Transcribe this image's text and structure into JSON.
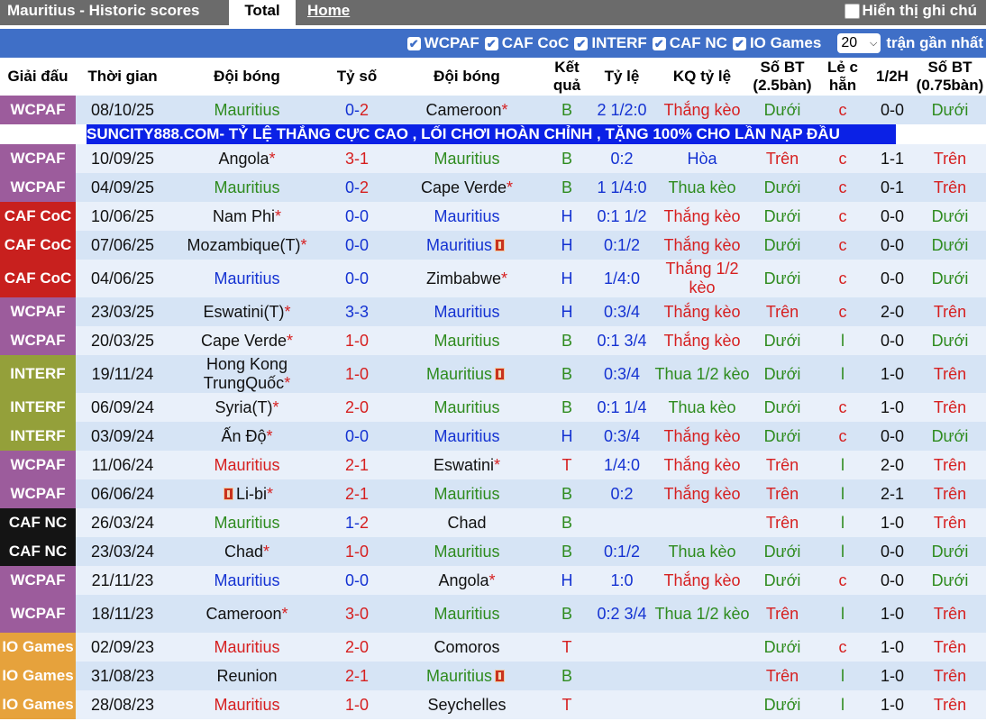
{
  "header": {
    "title": "Mauritius - Historic scores",
    "tab_total": "Total",
    "tab_home": "Home",
    "show_notes_label": "Hiển thị ghi chú"
  },
  "filters": {
    "items": [
      "WCPAF",
      "CAF CoC",
      "INTERF",
      "CAF NC",
      "IO Games"
    ],
    "select_value": "20",
    "recent_label": "trận gần nhất"
  },
  "columns": [
    "Giải đấu",
    "Thời gian",
    "Đội bóng",
    "Tỷ số",
    "Đội bóng",
    "Kết quả",
    "Tỷ lệ",
    "KQ tỷ lệ",
    "Số BT (2.5bàn)",
    "Lẻ c hẵn",
    "1/2H",
    "Số BT (0.75bàn)"
  ],
  "colors": {
    "WCPAF": "#9c5c9c",
    "CAF CoC": "#c8201e",
    "INTERF": "#94a03a",
    "CAF NC": "#141414",
    "IO Games": "#e6a23c",
    "ad_bg": "#0b21e6",
    "filter_bar": "#3f6fc7"
  },
  "ad_banner": "SUNCITY888.COM- TỶ LỆ THẮNG CỰC CAO , LỐI CHƠI HOÀN CHỈNH , TẶNG 100% CHO LẦN NẠP ĐẦU",
  "rows": [
    {
      "league": "WCPAF",
      "date": "08/10/25",
      "home": "Mauritius",
      "home_color": "green",
      "home_star": false,
      "home_flag": false,
      "score_home": "0",
      "score_away": "2",
      "score_home_color": "blue",
      "score_away_color": "red",
      "away": "Cameroon",
      "away_color": "black",
      "away_star": true,
      "away_flag": false,
      "result": "B",
      "result_color": "green",
      "odds": "2 1/2:0",
      "odds_color": "blue",
      "odds_result": "Thắng kèo",
      "odds_result_color": "red",
      "ou": "Dưới",
      "ou_color": "green",
      "oe": "c",
      "oe_color": "red",
      "half": "0-0",
      "ou75": "Dưới",
      "ou75_color": "green"
    },
    {
      "league": "WCPAF",
      "date": "10/09/25",
      "home": "Angola",
      "home_color": "black",
      "home_star": true,
      "home_flag": false,
      "score_home": "3",
      "score_away": "1",
      "score_home_color": "red",
      "score_away_color": "red",
      "away": "Mauritius",
      "away_color": "green",
      "away_star": false,
      "away_flag": false,
      "result": "B",
      "result_color": "green",
      "odds": "0:2",
      "odds_color": "blue",
      "odds_result": "Hòa",
      "odds_result_color": "blue",
      "ou": "Trên",
      "ou_color": "red",
      "oe": "c",
      "oe_color": "red",
      "half": "1-1",
      "ou75": "Trên",
      "ou75_color": "red"
    },
    {
      "league": "WCPAF",
      "date": "04/09/25",
      "home": "Mauritius",
      "home_color": "green",
      "home_star": false,
      "home_flag": false,
      "score_home": "0",
      "score_away": "2",
      "score_home_color": "blue",
      "score_away_color": "red",
      "away": "Cape Verde",
      "away_color": "black",
      "away_star": true,
      "away_flag": false,
      "result": "B",
      "result_color": "green",
      "odds": "1 1/4:0",
      "odds_color": "blue",
      "odds_result": "Thua kèo",
      "odds_result_color": "green",
      "ou": "Dưới",
      "ou_color": "green",
      "oe": "c",
      "oe_color": "red",
      "half": "0-1",
      "ou75": "Trên",
      "ou75_color": "red"
    },
    {
      "league": "CAF CoC",
      "date": "10/06/25",
      "home": "Nam Phi",
      "home_color": "black",
      "home_star": true,
      "home_flag": false,
      "score_home": "0",
      "score_away": "0",
      "score_home_color": "blue",
      "score_away_color": "blue",
      "away": "Mauritius",
      "away_color": "blue",
      "away_star": false,
      "away_flag": false,
      "result": "H",
      "result_color": "blue",
      "odds": "0:1 1/2",
      "odds_color": "blue",
      "odds_result": "Thắng kèo",
      "odds_result_color": "red",
      "ou": "Dưới",
      "ou_color": "green",
      "oe": "c",
      "oe_color": "red",
      "half": "0-0",
      "ou75": "Dưới",
      "ou75_color": "green"
    },
    {
      "league": "CAF CoC",
      "date": "07/06/25",
      "home": "Mozambique(T)",
      "home_color": "black",
      "home_star": true,
      "home_flag": false,
      "score_home": "0",
      "score_away": "0",
      "score_home_color": "blue",
      "score_away_color": "blue",
      "away": "Mauritius",
      "away_color": "blue",
      "away_star": false,
      "away_flag": true,
      "result": "H",
      "result_color": "blue",
      "odds": "0:1/2",
      "odds_color": "blue",
      "odds_result": "Thắng kèo",
      "odds_result_color": "red",
      "ou": "Dưới",
      "ou_color": "green",
      "oe": "c",
      "oe_color": "red",
      "half": "0-0",
      "ou75": "Dưới",
      "ou75_color": "green"
    },
    {
      "league": "CAF CoC",
      "date": "04/06/25",
      "home": "Mauritius",
      "home_color": "blue",
      "home_star": false,
      "home_flag": false,
      "score_home": "0",
      "score_away": "0",
      "score_home_color": "blue",
      "score_away_color": "blue",
      "away": "Zimbabwe",
      "away_color": "black",
      "away_star": true,
      "away_flag": false,
      "result": "H",
      "result_color": "blue",
      "odds": "1/4:0",
      "odds_color": "blue",
      "odds_result": "Thắng 1/2 kèo",
      "odds_result_color": "red",
      "ou": "Dưới",
      "ou_color": "green",
      "oe": "c",
      "oe_color": "red",
      "half": "0-0",
      "ou75": "Dưới",
      "ou75_color": "green",
      "tall": true
    },
    {
      "league": "WCPAF",
      "date": "23/03/25",
      "home": "Eswatini(T)",
      "home_color": "black",
      "home_star": true,
      "home_flag": false,
      "score_home": "3",
      "score_away": "3",
      "score_home_color": "blue",
      "score_away_color": "blue",
      "away": "Mauritius",
      "away_color": "blue",
      "away_star": false,
      "away_flag": false,
      "result": "H",
      "result_color": "blue",
      "odds": "0:3/4",
      "odds_color": "blue",
      "odds_result": "Thắng kèo",
      "odds_result_color": "red",
      "ou": "Trên",
      "ou_color": "red",
      "oe": "c",
      "oe_color": "red",
      "half": "2-0",
      "ou75": "Trên",
      "ou75_color": "red"
    },
    {
      "league": "WCPAF",
      "date": "20/03/25",
      "home": "Cape Verde",
      "home_color": "black",
      "home_star": true,
      "home_flag": false,
      "score_home": "1",
      "score_away": "0",
      "score_home_color": "red",
      "score_away_color": "red",
      "away": "Mauritius",
      "away_color": "green",
      "away_star": false,
      "away_flag": false,
      "result": "B",
      "result_color": "green",
      "odds": "0:1 3/4",
      "odds_color": "blue",
      "odds_result": "Thắng kèo",
      "odds_result_color": "red",
      "ou": "Dưới",
      "ou_color": "green",
      "oe": "l",
      "oe_color": "green",
      "half": "0-0",
      "ou75": "Dưới",
      "ou75_color": "green"
    },
    {
      "league": "INTERF",
      "date": "19/11/24",
      "home": "Hong Kong TrungQuốc",
      "home_color": "black",
      "home_star": true,
      "home_flag": false,
      "score_home": "1",
      "score_away": "0",
      "score_home_color": "red",
      "score_away_color": "red",
      "away": "Mauritius",
      "away_color": "green",
      "away_star": false,
      "away_flag": true,
      "result": "B",
      "result_color": "green",
      "odds": "0:3/4",
      "odds_color": "blue",
      "odds_result": "Thua 1/2 kèo",
      "odds_result_color": "green",
      "ou": "Dưới",
      "ou_color": "green",
      "oe": "l",
      "oe_color": "green",
      "half": "1-0",
      "ou75": "Trên",
      "ou75_color": "red",
      "tall": true
    },
    {
      "league": "INTERF",
      "date": "06/09/24",
      "home": "Syria(T)",
      "home_color": "black",
      "home_star": true,
      "home_flag": false,
      "score_home": "2",
      "score_away": "0",
      "score_home_color": "red",
      "score_away_color": "red",
      "away": "Mauritius",
      "away_color": "green",
      "away_star": false,
      "away_flag": false,
      "result": "B",
      "result_color": "green",
      "odds": "0:1 1/4",
      "odds_color": "blue",
      "odds_result": "Thua kèo",
      "odds_result_color": "green",
      "ou": "Dưới",
      "ou_color": "green",
      "oe": "c",
      "oe_color": "red",
      "half": "1-0",
      "ou75": "Trên",
      "ou75_color": "red"
    },
    {
      "league": "INTERF",
      "date": "03/09/24",
      "home": "Ấn Độ",
      "home_color": "black",
      "home_star": true,
      "home_flag": false,
      "score_home": "0",
      "score_away": "0",
      "score_home_color": "blue",
      "score_away_color": "blue",
      "away": "Mauritius",
      "away_color": "blue",
      "away_star": false,
      "away_flag": false,
      "result": "H",
      "result_color": "blue",
      "odds": "0:3/4",
      "odds_color": "blue",
      "odds_result": "Thắng kèo",
      "odds_result_color": "red",
      "ou": "Dưới",
      "ou_color": "green",
      "oe": "c",
      "oe_color": "red",
      "half": "0-0",
      "ou75": "Dưới",
      "ou75_color": "green"
    },
    {
      "league": "WCPAF",
      "date": "11/06/24",
      "home": "Mauritius",
      "home_color": "red",
      "home_star": false,
      "home_flag": false,
      "score_home": "2",
      "score_away": "1",
      "score_home_color": "red",
      "score_away_color": "red",
      "away": "Eswatini",
      "away_color": "black",
      "away_star": true,
      "away_flag": false,
      "result": "T",
      "result_color": "red",
      "odds": "1/4:0",
      "odds_color": "blue",
      "odds_result": "Thắng kèo",
      "odds_result_color": "red",
      "ou": "Trên",
      "ou_color": "red",
      "oe": "l",
      "oe_color": "green",
      "half": "2-0",
      "ou75": "Trên",
      "ou75_color": "red"
    },
    {
      "league": "WCPAF",
      "date": "06/06/24",
      "home": "Li-bi",
      "home_color": "black",
      "home_star": true,
      "home_flag": true,
      "score_home": "2",
      "score_away": "1",
      "score_home_color": "red",
      "score_away_color": "red",
      "away": "Mauritius",
      "away_color": "green",
      "away_star": false,
      "away_flag": false,
      "result": "B",
      "result_color": "green",
      "odds": "0:2",
      "odds_color": "blue",
      "odds_result": "Thắng kèo",
      "odds_result_color": "red",
      "ou": "Trên",
      "ou_color": "red",
      "oe": "l",
      "oe_color": "green",
      "half": "2-1",
      "ou75": "Trên",
      "ou75_color": "red"
    },
    {
      "league": "CAF NC",
      "date": "26/03/24",
      "home": "Mauritius",
      "home_color": "green",
      "home_star": false,
      "home_flag": false,
      "score_home": "1",
      "score_away": "2",
      "score_home_color": "blue",
      "score_away_color": "red",
      "away": "Chad",
      "away_color": "black",
      "away_star": false,
      "away_flag": false,
      "result": "B",
      "result_color": "green",
      "odds": "",
      "odds_color": "blue",
      "odds_result": "",
      "odds_result_color": "red",
      "ou": "Trên",
      "ou_color": "red",
      "oe": "l",
      "oe_color": "green",
      "half": "1-0",
      "ou75": "Trên",
      "ou75_color": "red"
    },
    {
      "league": "CAF NC",
      "date": "23/03/24",
      "home": "Chad",
      "home_color": "black",
      "home_star": true,
      "home_flag": false,
      "score_home": "1",
      "score_away": "0",
      "score_home_color": "red",
      "score_away_color": "red",
      "away": "Mauritius",
      "away_color": "green",
      "away_star": false,
      "away_flag": false,
      "result": "B",
      "result_color": "green",
      "odds": "0:1/2",
      "odds_color": "blue",
      "odds_result": "Thua kèo",
      "odds_result_color": "green",
      "ou": "Dưới",
      "ou_color": "green",
      "oe": "l",
      "oe_color": "green",
      "half": "0-0",
      "ou75": "Dưới",
      "ou75_color": "green"
    },
    {
      "league": "WCPAF",
      "date": "21/11/23",
      "home": "Mauritius",
      "home_color": "blue",
      "home_star": false,
      "home_flag": false,
      "score_home": "0",
      "score_away": "0",
      "score_home_color": "blue",
      "score_away_color": "blue",
      "away": "Angola",
      "away_color": "black",
      "away_star": true,
      "away_flag": false,
      "result": "H",
      "result_color": "blue",
      "odds": "1:0",
      "odds_color": "blue",
      "odds_result": "Thắng kèo",
      "odds_result_color": "red",
      "ou": "Dưới",
      "ou_color": "green",
      "oe": "c",
      "oe_color": "red",
      "half": "0-0",
      "ou75": "Dưới",
      "ou75_color": "green"
    },
    {
      "league": "WCPAF",
      "date": "18/11/23",
      "home": "Cameroon",
      "home_color": "black",
      "home_star": true,
      "home_flag": false,
      "score_home": "3",
      "score_away": "0",
      "score_home_color": "red",
      "score_away_color": "red",
      "away": "Mauritius",
      "away_color": "green",
      "away_star": false,
      "away_flag": false,
      "result": "B",
      "result_color": "green",
      "odds": "0:2 3/4",
      "odds_color": "blue",
      "odds_result": "Thua 1/2 kèo",
      "odds_result_color": "green",
      "ou": "Trên",
      "ou_color": "red",
      "oe": "l",
      "oe_color": "green",
      "half": "1-0",
      "ou75": "Trên",
      "ou75_color": "red",
      "tall": true
    },
    {
      "league": "IO Games",
      "date": "02/09/23",
      "home": "Mauritius",
      "home_color": "red",
      "home_star": false,
      "home_flag": false,
      "score_home": "2",
      "score_away": "0",
      "score_home_color": "red",
      "score_away_color": "red",
      "away": "Comoros",
      "away_color": "black",
      "away_star": false,
      "away_flag": false,
      "result": "T",
      "result_color": "red",
      "odds": "",
      "odds_color": "blue",
      "odds_result": "",
      "odds_result_color": "red",
      "ou": "Dưới",
      "ou_color": "green",
      "oe": "c",
      "oe_color": "red",
      "half": "1-0",
      "ou75": "Trên",
      "ou75_color": "red"
    },
    {
      "league": "IO Games",
      "date": "31/08/23",
      "home": "Reunion",
      "home_color": "black",
      "home_star": false,
      "home_flag": false,
      "score_home": "2",
      "score_away": "1",
      "score_home_color": "red",
      "score_away_color": "red",
      "away": "Mauritius",
      "away_color": "green",
      "away_star": false,
      "away_flag": true,
      "result": "B",
      "result_color": "green",
      "odds": "",
      "odds_color": "blue",
      "odds_result": "",
      "odds_result_color": "red",
      "ou": "Trên",
      "ou_color": "red",
      "oe": "l",
      "oe_color": "green",
      "half": "1-0",
      "ou75": "Trên",
      "ou75_color": "red"
    },
    {
      "league": "IO Games",
      "date": "28/08/23",
      "home": "Mauritius",
      "home_color": "red",
      "home_star": false,
      "home_flag": false,
      "score_home": "1",
      "score_away": "0",
      "score_home_color": "red",
      "score_away_color": "red",
      "away": "Seychelles",
      "away_color": "black",
      "away_star": false,
      "away_flag": false,
      "result": "T",
      "result_color": "red",
      "odds": "",
      "odds_color": "blue",
      "odds_result": "",
      "odds_result_color": "red",
      "ou": "Dưới",
      "ou_color": "green",
      "oe": "l",
      "oe_color": "green",
      "half": "1-0",
      "ou75": "Trên",
      "ou75_color": "red"
    }
  ]
}
